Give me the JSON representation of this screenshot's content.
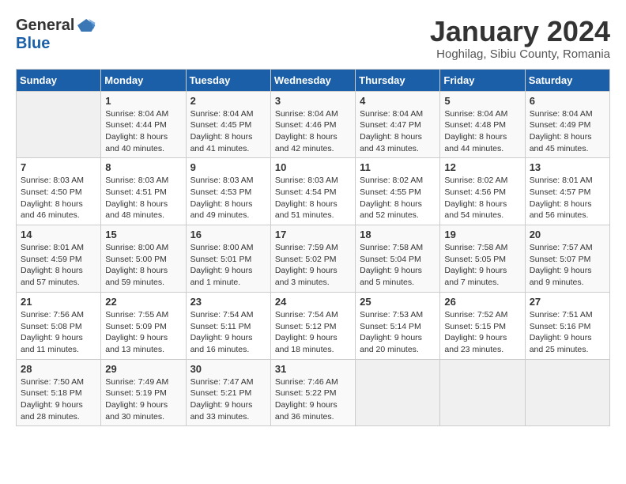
{
  "header": {
    "logo_general": "General",
    "logo_blue": "Blue",
    "title": "January 2024",
    "location": "Hoghilag, Sibiu County, Romania"
  },
  "days_of_week": [
    "Sunday",
    "Monday",
    "Tuesday",
    "Wednesday",
    "Thursday",
    "Friday",
    "Saturday"
  ],
  "weeks": [
    [
      {
        "day": "",
        "sunrise": "",
        "sunset": "",
        "daylight": ""
      },
      {
        "day": "1",
        "sunrise": "Sunrise: 8:04 AM",
        "sunset": "Sunset: 4:44 PM",
        "daylight": "Daylight: 8 hours and 40 minutes."
      },
      {
        "day": "2",
        "sunrise": "Sunrise: 8:04 AM",
        "sunset": "Sunset: 4:45 PM",
        "daylight": "Daylight: 8 hours and 41 minutes."
      },
      {
        "day": "3",
        "sunrise": "Sunrise: 8:04 AM",
        "sunset": "Sunset: 4:46 PM",
        "daylight": "Daylight: 8 hours and 42 minutes."
      },
      {
        "day": "4",
        "sunrise": "Sunrise: 8:04 AM",
        "sunset": "Sunset: 4:47 PM",
        "daylight": "Daylight: 8 hours and 43 minutes."
      },
      {
        "day": "5",
        "sunrise": "Sunrise: 8:04 AM",
        "sunset": "Sunset: 4:48 PM",
        "daylight": "Daylight: 8 hours and 44 minutes."
      },
      {
        "day": "6",
        "sunrise": "Sunrise: 8:04 AM",
        "sunset": "Sunset: 4:49 PM",
        "daylight": "Daylight: 8 hours and 45 minutes."
      }
    ],
    [
      {
        "day": "7",
        "sunrise": "Sunrise: 8:03 AM",
        "sunset": "Sunset: 4:50 PM",
        "daylight": "Daylight: 8 hours and 46 minutes."
      },
      {
        "day": "8",
        "sunrise": "Sunrise: 8:03 AM",
        "sunset": "Sunset: 4:51 PM",
        "daylight": "Daylight: 8 hours and 48 minutes."
      },
      {
        "day": "9",
        "sunrise": "Sunrise: 8:03 AM",
        "sunset": "Sunset: 4:53 PM",
        "daylight": "Daylight: 8 hours and 49 minutes."
      },
      {
        "day": "10",
        "sunrise": "Sunrise: 8:03 AM",
        "sunset": "Sunset: 4:54 PM",
        "daylight": "Daylight: 8 hours and 51 minutes."
      },
      {
        "day": "11",
        "sunrise": "Sunrise: 8:02 AM",
        "sunset": "Sunset: 4:55 PM",
        "daylight": "Daylight: 8 hours and 52 minutes."
      },
      {
        "day": "12",
        "sunrise": "Sunrise: 8:02 AM",
        "sunset": "Sunset: 4:56 PM",
        "daylight": "Daylight: 8 hours and 54 minutes."
      },
      {
        "day": "13",
        "sunrise": "Sunrise: 8:01 AM",
        "sunset": "Sunset: 4:57 PM",
        "daylight": "Daylight: 8 hours and 56 minutes."
      }
    ],
    [
      {
        "day": "14",
        "sunrise": "Sunrise: 8:01 AM",
        "sunset": "Sunset: 4:59 PM",
        "daylight": "Daylight: 8 hours and 57 minutes."
      },
      {
        "day": "15",
        "sunrise": "Sunrise: 8:00 AM",
        "sunset": "Sunset: 5:00 PM",
        "daylight": "Daylight: 8 hours and 59 minutes."
      },
      {
        "day": "16",
        "sunrise": "Sunrise: 8:00 AM",
        "sunset": "Sunset: 5:01 PM",
        "daylight": "Daylight: 9 hours and 1 minute."
      },
      {
        "day": "17",
        "sunrise": "Sunrise: 7:59 AM",
        "sunset": "Sunset: 5:02 PM",
        "daylight": "Daylight: 9 hours and 3 minutes."
      },
      {
        "day": "18",
        "sunrise": "Sunrise: 7:58 AM",
        "sunset": "Sunset: 5:04 PM",
        "daylight": "Daylight: 9 hours and 5 minutes."
      },
      {
        "day": "19",
        "sunrise": "Sunrise: 7:58 AM",
        "sunset": "Sunset: 5:05 PM",
        "daylight": "Daylight: 9 hours and 7 minutes."
      },
      {
        "day": "20",
        "sunrise": "Sunrise: 7:57 AM",
        "sunset": "Sunset: 5:07 PM",
        "daylight": "Daylight: 9 hours and 9 minutes."
      }
    ],
    [
      {
        "day": "21",
        "sunrise": "Sunrise: 7:56 AM",
        "sunset": "Sunset: 5:08 PM",
        "daylight": "Daylight: 9 hours and 11 minutes."
      },
      {
        "day": "22",
        "sunrise": "Sunrise: 7:55 AM",
        "sunset": "Sunset: 5:09 PM",
        "daylight": "Daylight: 9 hours and 13 minutes."
      },
      {
        "day": "23",
        "sunrise": "Sunrise: 7:54 AM",
        "sunset": "Sunset: 5:11 PM",
        "daylight": "Daylight: 9 hours and 16 minutes."
      },
      {
        "day": "24",
        "sunrise": "Sunrise: 7:54 AM",
        "sunset": "Sunset: 5:12 PM",
        "daylight": "Daylight: 9 hours and 18 minutes."
      },
      {
        "day": "25",
        "sunrise": "Sunrise: 7:53 AM",
        "sunset": "Sunset: 5:14 PM",
        "daylight": "Daylight: 9 hours and 20 minutes."
      },
      {
        "day": "26",
        "sunrise": "Sunrise: 7:52 AM",
        "sunset": "Sunset: 5:15 PM",
        "daylight": "Daylight: 9 hours and 23 minutes."
      },
      {
        "day": "27",
        "sunrise": "Sunrise: 7:51 AM",
        "sunset": "Sunset: 5:16 PM",
        "daylight": "Daylight: 9 hours and 25 minutes."
      }
    ],
    [
      {
        "day": "28",
        "sunrise": "Sunrise: 7:50 AM",
        "sunset": "Sunset: 5:18 PM",
        "daylight": "Daylight: 9 hours and 28 minutes."
      },
      {
        "day": "29",
        "sunrise": "Sunrise: 7:49 AM",
        "sunset": "Sunset: 5:19 PM",
        "daylight": "Daylight: 9 hours and 30 minutes."
      },
      {
        "day": "30",
        "sunrise": "Sunrise: 7:47 AM",
        "sunset": "Sunset: 5:21 PM",
        "daylight": "Daylight: 9 hours and 33 minutes."
      },
      {
        "day": "31",
        "sunrise": "Sunrise: 7:46 AM",
        "sunset": "Sunset: 5:22 PM",
        "daylight": "Daylight: 9 hours and 36 minutes."
      },
      {
        "day": "",
        "sunrise": "",
        "sunset": "",
        "daylight": ""
      },
      {
        "day": "",
        "sunrise": "",
        "sunset": "",
        "daylight": ""
      },
      {
        "day": "",
        "sunrise": "",
        "sunset": "",
        "daylight": ""
      }
    ]
  ]
}
